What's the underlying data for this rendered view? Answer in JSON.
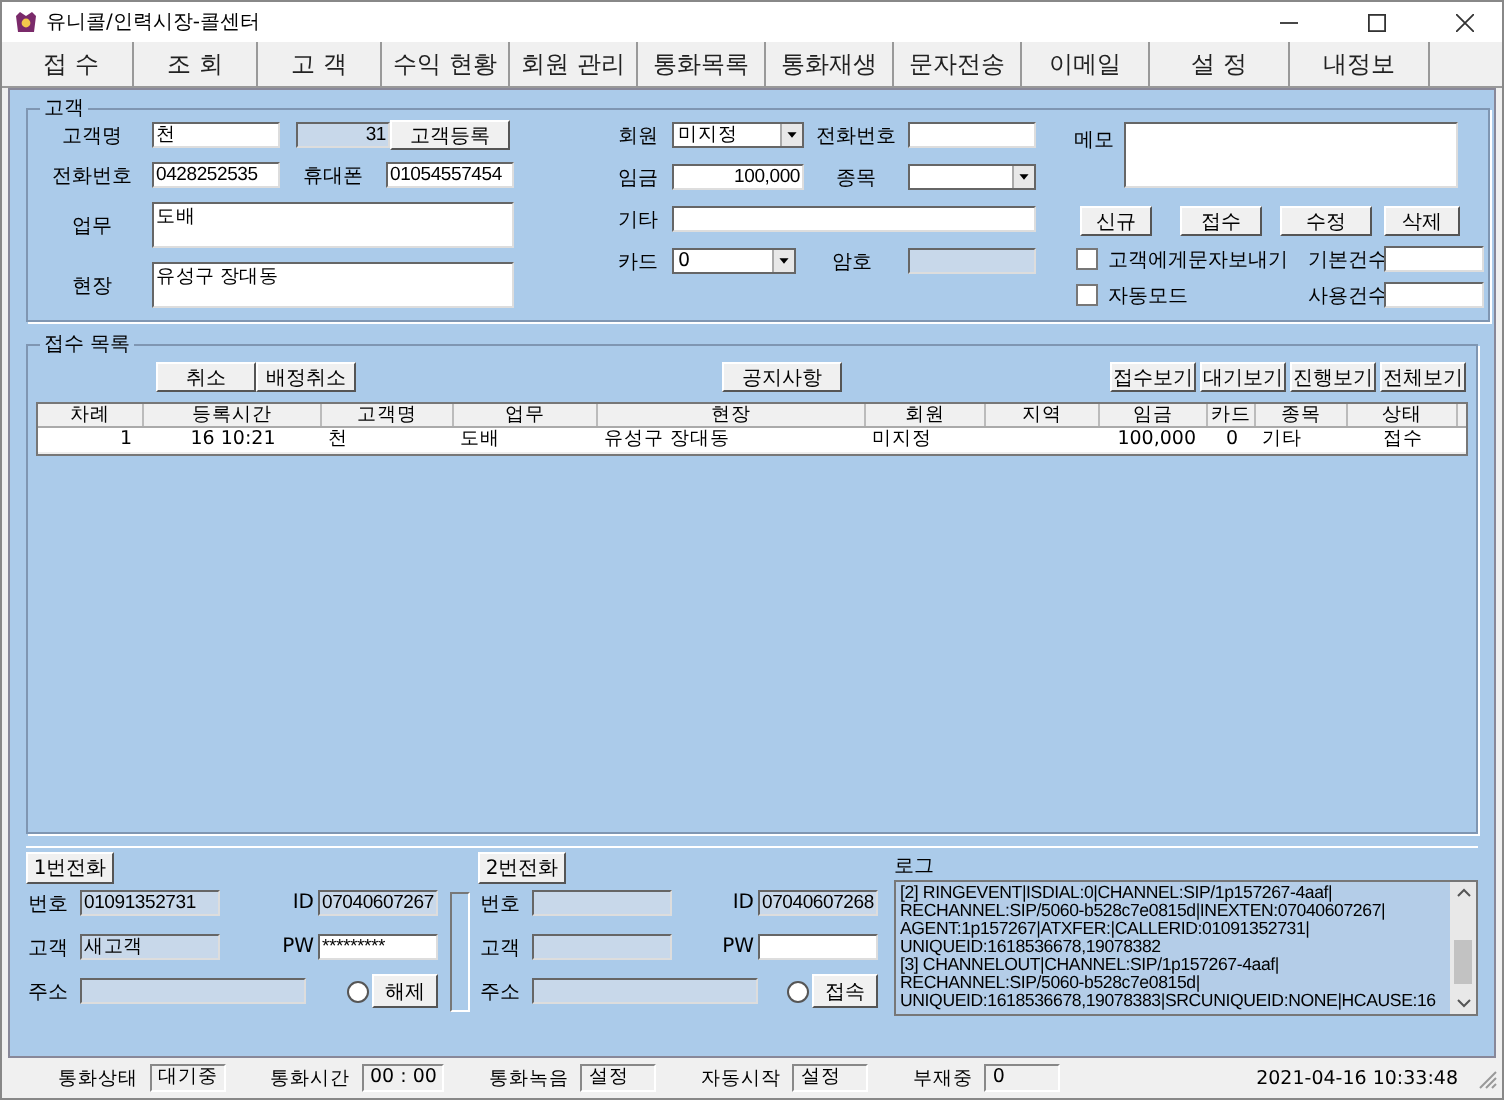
{
  "window": {
    "title": "유니콜/인력시장-콜센터"
  },
  "tabs": [
    {
      "label": "접 수"
    },
    {
      "label": "조 회"
    },
    {
      "label": "고 객"
    },
    {
      "label": "수익 현황"
    },
    {
      "label": "회원 관리"
    },
    {
      "label": "통화목록"
    },
    {
      "label": "통화재생"
    },
    {
      "label": "문자전송"
    },
    {
      "label": "이메일"
    },
    {
      "label": "설 정"
    },
    {
      "label": "내정보"
    }
  ],
  "customer": {
    "title": "고객",
    "name": {
      "label": "고객명",
      "value": "천"
    },
    "count": "31",
    "register_button": "고객등록",
    "phone": {
      "label": "전화번호",
      "value": "0428252535"
    },
    "mobile": {
      "label": "휴대폰",
      "value": "01054557454"
    },
    "job": {
      "label": "업무",
      "value": "도배"
    },
    "site": {
      "label": "현장",
      "value": "유성구 장대동"
    },
    "member": {
      "label": "회원",
      "value": "미지정"
    },
    "tel": {
      "label": "전화번호"
    },
    "wage": {
      "label": "임금",
      "value": "100,000"
    },
    "category": {
      "label": "종목"
    },
    "etc": {
      "label": "기타"
    },
    "card": {
      "label": "카드",
      "value": "0"
    },
    "password": {
      "label": "암호"
    },
    "memo": {
      "label": "메모"
    },
    "buttons": [
      "신규",
      "접수",
      "수정",
      "삭제"
    ],
    "checkboxes": [
      {
        "label": "고객에게문자보내기",
        "checked": false
      },
      {
        "label": "자동모드",
        "checked": false
      }
    ],
    "counts": [
      {
        "label": "기본건수"
      },
      {
        "label": "사용건수"
      }
    ]
  },
  "list": {
    "title": "접수 목록",
    "left_buttons": [
      "취소",
      "배정취소"
    ],
    "notice_button": "공지사항",
    "view_buttons": [
      "접수보기",
      "대기보기",
      "진행보기",
      "전체보기"
    ],
    "columns": [
      "차례",
      "등록시간",
      "고객명",
      "업무",
      "현장",
      "회원",
      "지역",
      "임금",
      "카드",
      "종목",
      "상태"
    ],
    "rows": [
      [
        "1",
        "16 10:21",
        "천",
        "도배",
        "유성구 장대동",
        "미지정",
        null,
        "100,000",
        "0",
        "기타",
        "접수"
      ]
    ]
  },
  "phones": [
    {
      "button": "1번전화",
      "number_label": "번호",
      "number": "01091352731",
      "id_label": "ID",
      "id": "07040607267",
      "customer_label": "고객",
      "customer": "새고객",
      "pw_label": "PW",
      "pw": "*********",
      "address_label": "주소",
      "action": "해제"
    },
    {
      "button": "2번전화",
      "number_label": "번호",
      "id_label": "ID",
      "id": "07040607268",
      "customer_label": "고객",
      "pw_label": "PW",
      "address_label": "주소",
      "action": "접속"
    }
  ],
  "log": {
    "label": "로그",
    "lines": [
      "[2] RINGEVENT|ISDIAL:0|CHANNEL:SIP/1p157267-4aaf|",
      "RECHANNEL:SIP/5060-b528c7e0815d|INEXTEN:07040607267|",
      "AGENT:1p157267|ATXFER:|CALLERID:01091352731|",
      "UNIQUEID:1618536678,19078382",
      "[3] CHANNELOUT|CHANNEL:SIP/1p157267-4aaf|",
      "RECHANNEL:SIP/5060-b528c7e0815d|",
      "UNIQUEID:1618536678,19078383|SRCUNIQUEID:NONE|HCAUSE:16"
    ]
  },
  "status_bar": {
    "items": [
      {
        "label": "통화상태",
        "value": "대기중"
      },
      {
        "label": "통화시간",
        "value": "00 : 00"
      },
      {
        "label": "통화녹음",
        "value": "설정"
      },
      {
        "label": "자동시작",
        "value": "설정"
      },
      {
        "label": "부재중",
        "value": "0"
      }
    ],
    "datetime": "2021-04-16 10:33:48"
  }
}
